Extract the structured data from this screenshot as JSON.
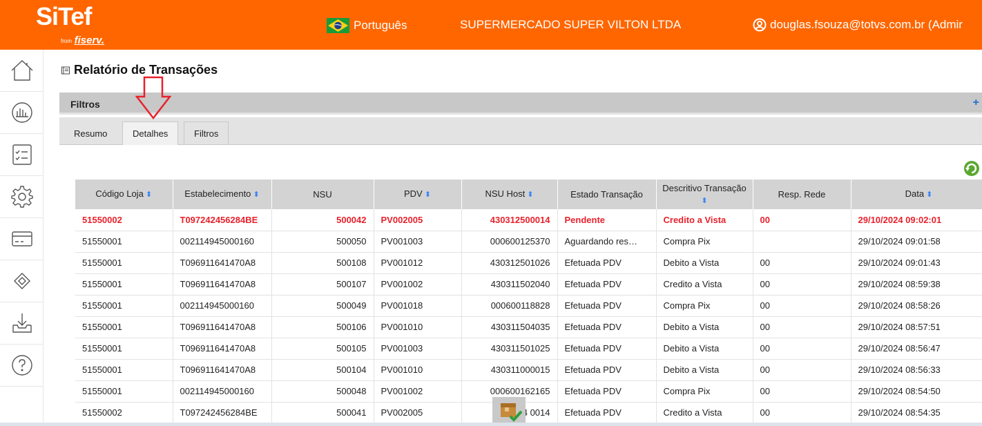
{
  "header": {
    "logo_main": "SiTef",
    "logo_from": "from",
    "logo_brand": "fiserv.",
    "language": "Português",
    "company": "SUPERMERCADO SUPER VILTON LTDA",
    "user": "douglas.fsouza@totvs.com.br (Admir",
    "brand_color": "#ff6600"
  },
  "sidebar": {
    "items": [
      {
        "icon": "home-icon"
      },
      {
        "icon": "chart-icon"
      },
      {
        "icon": "checklist-icon"
      },
      {
        "icon": "gear-icon"
      },
      {
        "icon": "card-icon"
      },
      {
        "icon": "diamond-icon"
      },
      {
        "icon": "download-icon"
      },
      {
        "icon": "help-icon"
      }
    ]
  },
  "page": {
    "title": "Relatório de Transações",
    "filters_label": "Filtros",
    "filters_toggle": "+"
  },
  "tabs": [
    {
      "label": "Resumo"
    },
    {
      "label": "Detalhes"
    },
    {
      "label": "Filtros"
    }
  ],
  "table": {
    "columns": [
      {
        "label": "Código Loja",
        "sortable": true
      },
      {
        "label": "Estabelecimento",
        "sortable": true
      },
      {
        "label": "NSU",
        "sortable": false
      },
      {
        "label": "PDV",
        "sortable": true
      },
      {
        "label": "NSU Host",
        "sortable": true
      },
      {
        "label": "Estado Transação",
        "sortable": false
      },
      {
        "label": "Descritivo Transação",
        "sortable": true
      },
      {
        "label": "Resp. Rede",
        "sortable": false
      },
      {
        "label": "Data",
        "sortable": true
      }
    ],
    "rows": [
      {
        "highlight": true,
        "cells": [
          "51550002",
          "T097242456284BE",
          "500042",
          "PV002005",
          "430312500014",
          "Pendente",
          "Credito a Vista",
          "00",
          "29/10/2024 09:02:01"
        ]
      },
      {
        "highlight": false,
        "cells": [
          "51550001",
          "002114945000160",
          "500050",
          "PV001003",
          "000600125370",
          "Aguardando res…",
          "Compra Pix",
          "",
          "29/10/2024 09:01:58"
        ]
      },
      {
        "highlight": false,
        "cells": [
          "51550001",
          "T096911641470A8",
          "500108",
          "PV001012",
          "430312501026",
          "Efetuada PDV",
          "Debito a Vista",
          "00",
          "29/10/2024 09:01:43"
        ]
      },
      {
        "highlight": false,
        "cells": [
          "51550001",
          "T096911641470A8",
          "500107",
          "PV001002",
          "430311502040",
          "Efetuada PDV",
          "Credito a Vista",
          "00",
          "29/10/2024 08:59:38"
        ]
      },
      {
        "highlight": false,
        "cells": [
          "51550001",
          "002114945000160",
          "500049",
          "PV001018",
          "000600118828",
          "Efetuada PDV",
          "Compra Pix",
          "00",
          "29/10/2024 08:58:26"
        ]
      },
      {
        "highlight": false,
        "cells": [
          "51550001",
          "T096911641470A8",
          "500106",
          "PV001010",
          "430311504035",
          "Efetuada PDV",
          "Debito a Vista",
          "00",
          "29/10/2024 08:57:51"
        ]
      },
      {
        "highlight": false,
        "cells": [
          "51550001",
          "T096911641470A8",
          "500105",
          "PV001003",
          "430311501025",
          "Efetuada PDV",
          "Debito a Vista",
          "00",
          "29/10/2024 08:56:47"
        ]
      },
      {
        "highlight": false,
        "cells": [
          "51550001",
          "T096911641470A8",
          "500104",
          "PV001010",
          "430311000015",
          "Efetuada PDV",
          "Debito a Vista",
          "00",
          "29/10/2024 08:56:33"
        ]
      },
      {
        "highlight": false,
        "cells": [
          "51550001",
          "002114945000160",
          "500048",
          "PV001002",
          "000600162165",
          "Efetuada PDV",
          "Compra Pix",
          "00",
          "29/10/2024 08:54:50"
        ]
      },
      {
        "highlight": false,
        "cells": [
          "51550002",
          "T097242456284BE",
          "500041",
          "PV002005",
          "4          0014",
          "Efetuada PDV",
          "Credito a Vista",
          "00",
          "29/10/2024 08:54:35"
        ]
      }
    ]
  }
}
